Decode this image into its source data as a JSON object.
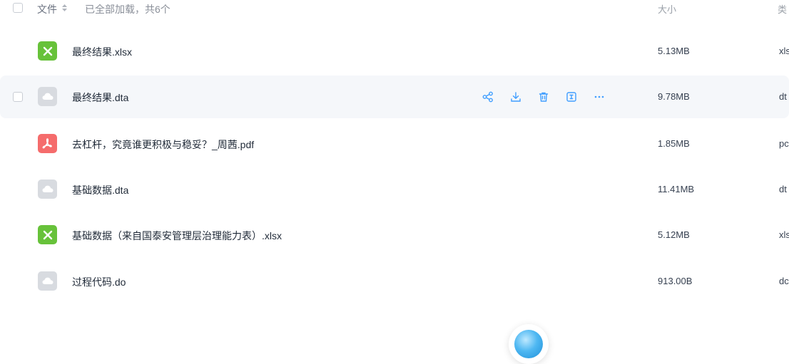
{
  "header": {
    "file_label": "文件",
    "loaded_text": "已全部加载，共6个",
    "size_label": "大小",
    "type_label": "类"
  },
  "files": [
    {
      "name": "最终结果.xlsx",
      "size": "5.13MB",
      "type": "xls",
      "icon": "excel-file-icon"
    },
    {
      "name": "最终结果.dta",
      "size": "9.78MB",
      "type": "dt",
      "icon": "cloud-file-icon"
    },
    {
      "name": "去杠杆，究竟谁更积极与稳妥？_周茜.pdf",
      "size": "1.85MB",
      "type": "pc",
      "icon": "pdf-file-icon"
    },
    {
      "name": "基础数据.dta",
      "size": "11.41MB",
      "type": "dt",
      "icon": "cloud-file-icon"
    },
    {
      "name": "基础数据（来自国泰安管理层治理能力表）.xlsx",
      "size": "5.12MB",
      "type": "xls",
      "icon": "excel-file-icon"
    },
    {
      "name": "过程代码.do",
      "size": "913.00B",
      "type": "dc",
      "icon": "cloud-file-icon"
    }
  ],
  "row_actions": [
    "share-icon",
    "download-icon",
    "delete-icon",
    "rename-icon",
    "more-icon"
  ],
  "colors": {
    "accent": "#409eff",
    "excel": "#67c23a",
    "pdf": "#f56c6c",
    "generic": "#d8dbe0",
    "hover_row": "#f5f7fa"
  }
}
